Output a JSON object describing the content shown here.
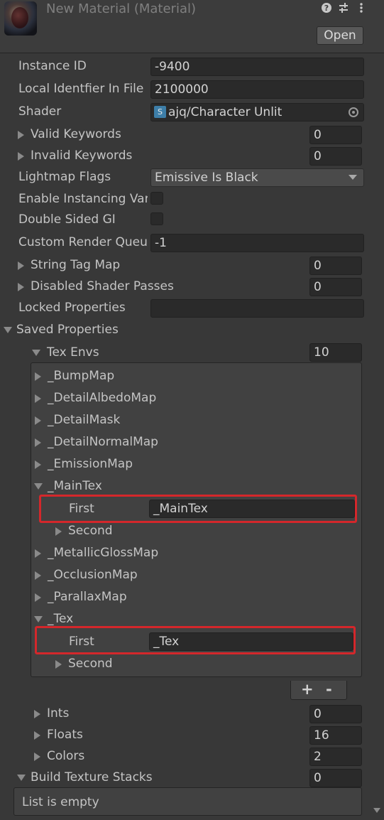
{
  "header": {
    "title": "New Material (Material)",
    "open_label": "Open",
    "icons": [
      "help-icon",
      "settings-sliders-icon",
      "more-options-icon"
    ]
  },
  "properties": {
    "instance_id": {
      "label": "Instance ID",
      "value": "-9400"
    },
    "local_identifier": {
      "label": "Local Identfier In File",
      "value": "2100000"
    },
    "shader": {
      "label": "Shader",
      "value": "ajq/Character Unlit",
      "icon_letter": "S"
    },
    "valid_keywords": {
      "label": "Valid Keywords",
      "value": "0"
    },
    "invalid_keywords": {
      "label": "Invalid Keywords",
      "value": "0"
    },
    "lightmap_flags": {
      "label": "Lightmap Flags",
      "value": "Emissive Is Black"
    },
    "enable_instancing": {
      "label": "Enable Instancing Var"
    },
    "double_sided_gi": {
      "label": "Double Sided GI"
    },
    "custom_render_queue": {
      "label": "Custom Render Queu",
      "value": "-1"
    },
    "string_tag_map": {
      "label": "String Tag Map",
      "value": "0"
    },
    "disabled_shader_passes": {
      "label": "Disabled Shader Passes",
      "value": "0"
    },
    "locked_properties": {
      "label": "Locked Properties",
      "value": ""
    }
  },
  "saved_properties": {
    "label": "Saved Properties",
    "tex_envs": {
      "label": "Tex Envs",
      "count": "10",
      "items": [
        {
          "label": "_BumpMap"
        },
        {
          "label": "_DetailAlbedoMap"
        },
        {
          "label": "_DetailMask"
        },
        {
          "label": "_DetailNormalMap"
        },
        {
          "label": "_EmissionMap"
        },
        {
          "label": "_MainTex",
          "first_label": "First",
          "first_value": "_MainTex",
          "second_label": "Second"
        },
        {
          "label": "_MetallicGlossMap"
        },
        {
          "label": "_OcclusionMap"
        },
        {
          "label": "_ParallaxMap"
        },
        {
          "label": "_Tex",
          "first_label": "First",
          "first_value": "_Tex",
          "second_label": "Second"
        }
      ],
      "add_label": "+",
      "remove_label": "-"
    },
    "ints": {
      "label": "Ints",
      "value": "0"
    },
    "floats": {
      "label": "Floats",
      "value": "16"
    },
    "colors": {
      "label": "Colors",
      "value": "2"
    }
  },
  "build_texture_stacks": {
    "label": "Build Texture Stacks",
    "value": "0",
    "empty_text": "List is empty"
  },
  "colors": {
    "highlight": "#d4272b",
    "background": "#383838",
    "field": "#2a2a2a"
  }
}
